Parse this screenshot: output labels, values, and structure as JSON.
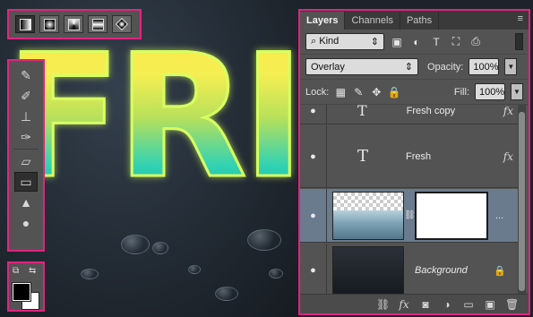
{
  "canvas": {
    "art_text": "FRI"
  },
  "options_bar": {
    "gradient_types": [
      {
        "icon": "linear-gradient-icon",
        "active": true
      },
      {
        "icon": "radial-gradient-icon"
      },
      {
        "icon": "angle-gradient-icon"
      },
      {
        "icon": "reflected-gradient-icon"
      },
      {
        "icon": "diamond-gradient-icon"
      }
    ]
  },
  "toolbox": {
    "tools": [
      {
        "icon": "spot-healing-brush-icon",
        "glyph": "✎"
      },
      {
        "icon": "brush-icon",
        "glyph": "✐"
      },
      {
        "icon": "clone-stamp-icon",
        "glyph": "⊥"
      },
      {
        "icon": "history-brush-icon",
        "glyph": "✑"
      },
      {
        "icon": "eraser-icon",
        "glyph": "▱"
      },
      {
        "icon": "gradient-tool-icon",
        "glyph": "▭",
        "active": true
      },
      {
        "icon": "blur-tool-icon",
        "glyph": "▲"
      },
      {
        "icon": "sponge-tool-icon",
        "glyph": "●"
      }
    ]
  },
  "swatches": {
    "foreground": "#000000",
    "background": "#ffffff",
    "default_colors_icon": "⧉",
    "swap_colors_icon": "⇆"
  },
  "layers_panel": {
    "tabs": [
      "Layers",
      "Channels",
      "Paths"
    ],
    "menu_icon": "≡",
    "filter": {
      "kind_label": "Kind",
      "search_glyph": "⌕",
      "icons": [
        "▣",
        "◐",
        "T",
        "⛶",
        "⎙"
      ]
    },
    "blend_mode": "Overlay",
    "opacity_label": "Opacity:",
    "opacity_value": "100%",
    "lock_label": "Lock:",
    "lock_icons": [
      "▦",
      "✎",
      "✥",
      "🔒"
    ],
    "fill_label": "Fill:",
    "fill_value": "100%",
    "layers": [
      {
        "name": "Fresh copy",
        "type": "text",
        "fx": "fx"
      },
      {
        "name": "Fresh",
        "type": "text",
        "fx": "fx"
      },
      {
        "name": "",
        "type": "masked-image",
        "selected": true,
        "more": "..."
      },
      {
        "name": "Background",
        "type": "background"
      }
    ],
    "eye_glyph": "●",
    "link_glyph": "⛓",
    "lock_glyph": "🔒",
    "footer_icons": [
      "⛓",
      "fx",
      "◙",
      "◑",
      "▭",
      "▣",
      "🗑"
    ]
  }
}
